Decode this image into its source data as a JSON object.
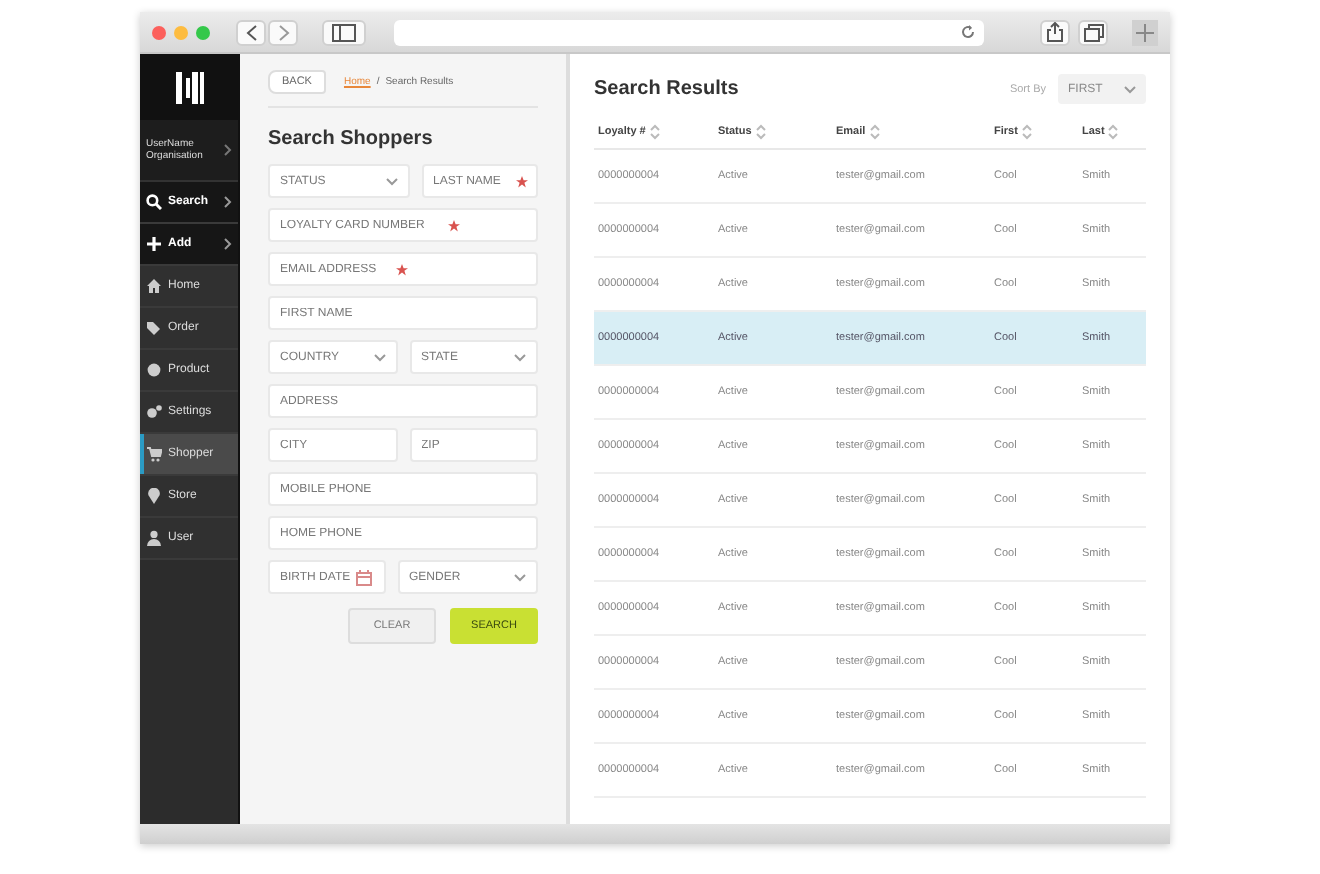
{
  "sidebar": {
    "user": {
      "name": "UserName",
      "org": "Organisation"
    },
    "items": [
      {
        "label": "Search",
        "kind": "menu",
        "selected": false
      },
      {
        "label": "Add",
        "kind": "menu",
        "selected": false
      },
      {
        "label": "Home",
        "kind": "link",
        "selected": false
      },
      {
        "label": "Order",
        "kind": "link",
        "selected": false
      },
      {
        "label": "Product",
        "kind": "link",
        "selected": false
      },
      {
        "label": "Settings",
        "kind": "link",
        "selected": false
      },
      {
        "label": "Shopper",
        "kind": "link",
        "selected": true
      },
      {
        "label": "Store",
        "kind": "link",
        "selected": false
      },
      {
        "label": "User",
        "kind": "link",
        "selected": false
      }
    ]
  },
  "form": {
    "back": "BACK",
    "breadcrumb": [
      {
        "label": "Home",
        "kind": "link"
      },
      {
        "label": "/",
        "kind": "separator"
      },
      {
        "label": "Search Results",
        "kind": "current"
      }
    ],
    "title": "Search Shoppers",
    "rows": [
      [
        {
          "kind": "select",
          "label": "STATUS"
        },
        {
          "kind": "text",
          "placeholder": "LAST NAME",
          "required": true
        }
      ],
      [
        {
          "kind": "text",
          "placeholder": "LOYALTY CARD NUMBER",
          "required": true
        }
      ],
      [
        {
          "kind": "text",
          "placeholder": "EMAIL ADDRESS",
          "required": true
        }
      ],
      [
        {
          "kind": "text",
          "placeholder": "FIRST NAME",
          "required": false
        }
      ],
      [
        {
          "kind": "select",
          "label": "COUNTRY"
        },
        {
          "kind": "select",
          "label": "STATE"
        }
      ],
      [
        {
          "kind": "text",
          "placeholder": "ADDRESS",
          "required": false
        }
      ],
      [
        {
          "kind": "text",
          "placeholder": "CITY",
          "required": false
        },
        {
          "kind": "text",
          "placeholder": "ZIP",
          "required": false
        }
      ],
      [
        {
          "kind": "text",
          "placeholder": "MOBILE PHONE",
          "required": false
        }
      ],
      [
        {
          "kind": "text",
          "placeholder": "HOME PHONE",
          "required": false
        }
      ],
      [
        {
          "kind": "date",
          "placeholder": "BIRTH DATE"
        },
        {
          "kind": "select",
          "label": "GENDER"
        }
      ]
    ],
    "buttons": [
      {
        "label": "CLEAR",
        "kind": "secondary"
      },
      {
        "label": "SEARCH",
        "kind": "primary"
      }
    ]
  },
  "results": {
    "title": "Search Results",
    "sort_label": "Sort By",
    "sort_value": "FIRST",
    "columns": [
      "Loyalty #",
      "Status",
      "Email",
      "First",
      "Last"
    ],
    "rows": [
      {
        "cells": [
          "0000000004",
          "Active",
          "tester@gmail.com",
          "Cool",
          "Smith"
        ],
        "selected": false
      },
      {
        "cells": [
          "0000000004",
          "Active",
          "tester@gmail.com",
          "Cool",
          "Smith"
        ],
        "selected": false
      },
      {
        "cells": [
          "0000000004",
          "Active",
          "tester@gmail.com",
          "Cool",
          "Smith"
        ],
        "selected": false
      },
      {
        "cells": [
          "0000000004",
          "Active",
          "tester@gmail.com",
          "Cool",
          "Smith"
        ],
        "selected": true
      },
      {
        "cells": [
          "0000000004",
          "Active",
          "tester@gmail.com",
          "Cool",
          "Smith"
        ],
        "selected": false
      },
      {
        "cells": [
          "0000000004",
          "Active",
          "tester@gmail.com",
          "Cool",
          "Smith"
        ],
        "selected": false
      },
      {
        "cells": [
          "0000000004",
          "Active",
          "tester@gmail.com",
          "Cool",
          "Smith"
        ],
        "selected": false
      },
      {
        "cells": [
          "0000000004",
          "Active",
          "tester@gmail.com",
          "Cool",
          "Smith"
        ],
        "selected": false
      },
      {
        "cells": [
          "0000000004",
          "Active",
          "tester@gmail.com",
          "Cool",
          "Smith"
        ],
        "selected": false
      },
      {
        "cells": [
          "0000000004",
          "Active",
          "tester@gmail.com",
          "Cool",
          "Smith"
        ],
        "selected": false
      },
      {
        "cells": [
          "0000000004",
          "Active",
          "tester@gmail.com",
          "Cool",
          "Smith"
        ],
        "selected": false
      },
      {
        "cells": [
          "0000000004",
          "Active",
          "tester@gmail.com",
          "Cool",
          "Smith"
        ],
        "selected": false
      }
    ]
  }
}
